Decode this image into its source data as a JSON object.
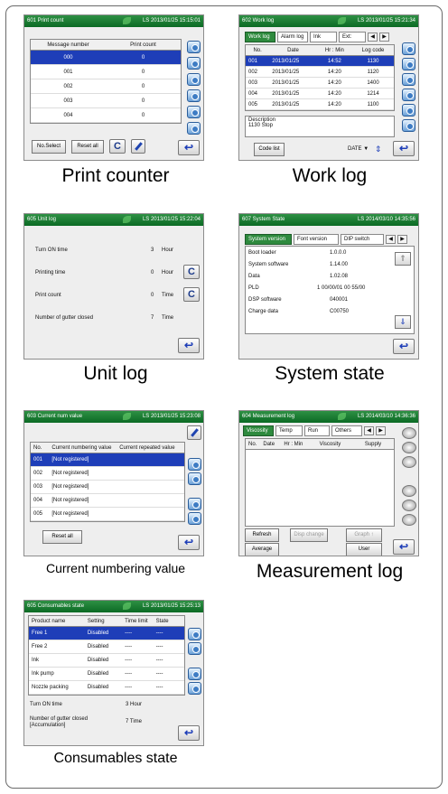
{
  "print_counter": {
    "title": "601 Print count",
    "datetime": "LS 2013/01/25 15:15:01",
    "headers": [
      "Message number",
      "Print count"
    ],
    "rows": [
      [
        "000",
        "0"
      ],
      [
        "001",
        "0"
      ],
      [
        "002",
        "0"
      ],
      [
        "003",
        "0"
      ],
      [
        "004",
        "0"
      ]
    ],
    "no_select": "No.Select",
    "reset_all": "Reset all",
    "c_glyph": "C",
    "caption": "Print counter"
  },
  "work_log": {
    "title": "602 Work log",
    "datetime": "LS 2013/01/25 15:21:34",
    "tabs": [
      "Work log",
      "Alarm log",
      "Ink",
      "Ext:"
    ],
    "headers": [
      "No.",
      "Date",
      "Hr : Min",
      "Log code"
    ],
    "rows": [
      [
        "001",
        "2013/01/25",
        "14:52",
        "1130"
      ],
      [
        "002",
        "2013/01/25",
        "14:20",
        "1120"
      ],
      [
        "003",
        "2013/01/25",
        "14:20",
        "1400"
      ],
      [
        "004",
        "2013/01/25",
        "14:20",
        "1214"
      ],
      [
        "005",
        "2013/01/25",
        "14:20",
        "1100"
      ]
    ],
    "description_label": "Description",
    "description": "1130 Stop",
    "code_list": "Code list",
    "sort": "DATE ▼",
    "caption": "Work log"
  },
  "unit_log": {
    "title": "605 Unit log",
    "datetime": "LS 2013/01/25 15:22:04",
    "items": [
      {
        "label": "Turn ON time",
        "value": "3",
        "unit": "Hour"
      },
      {
        "label": "Printing time",
        "value": "0",
        "unit": "Hour"
      },
      {
        "label": "Print count",
        "value": "0",
        "unit": "Time"
      },
      {
        "label": "Number of gutter closed",
        "value": "7",
        "unit": "Time"
      }
    ],
    "caption": "Unit log"
  },
  "system_state": {
    "title": "607 System State",
    "datetime": "LS 2014/03/10 14:35:56",
    "tabs": [
      "System version",
      "Font version",
      "DIP switch"
    ],
    "items": [
      {
        "label": "Boot loader",
        "value": "1.0.0.0"
      },
      {
        "label": "System software",
        "value": "1.14.00"
      },
      {
        "label": "Data",
        "value": "1.02.08"
      },
      {
        "label": "PLD",
        "value": "1 00/00/01  00  55/00"
      },
      {
        "label": "DSP software",
        "value": "040001"
      },
      {
        "label": "Charge data",
        "value": "C00750"
      }
    ],
    "caption": "System state"
  },
  "numbering": {
    "title": "603 Current num value",
    "datetime": "LS 2013/01/25 15:23:08",
    "headers": [
      "No.",
      "Current numbering value",
      "Current repeated value"
    ],
    "rows": [
      [
        "001",
        "[Not registered]"
      ],
      [
        "002",
        "[Not registered]"
      ],
      [
        "003",
        "[Not registered]"
      ],
      [
        "004",
        "[Not registered]"
      ],
      [
        "005",
        "[Not registered]"
      ]
    ],
    "reset_all": "Reset all",
    "caption": "Current numbering value"
  },
  "measurement": {
    "title": "604 Measurement log",
    "datetime": "LS 2014/03/10 14:36:36",
    "tabs": [
      "Viscosity",
      "Temp",
      "Run",
      "Others"
    ],
    "headers": [
      "No.",
      "Date",
      "Hr : Min",
      "Viscosity",
      "Supply"
    ],
    "refresh": "Refresh",
    "disp_change": "Disp change",
    "graph": "Graph ↑",
    "average": "Average",
    "user": "User",
    "caption": "Measurement log"
  },
  "consumables": {
    "title": "605 Consumables state",
    "datetime": "LS 2013/01/25 15:25:13",
    "headers": [
      "Product name",
      "Setting",
      "Time limit",
      "State"
    ],
    "rows": [
      [
        "Free 1",
        "Disabled",
        "----",
        "----"
      ],
      [
        "Free 2",
        "Disabled",
        "----",
        "----"
      ],
      [
        "Ink",
        "Disabled",
        "----",
        "----"
      ],
      [
        "Ink pump",
        "Disabled",
        "----",
        "----"
      ],
      [
        "Nozzle packing",
        "Disabled",
        "----",
        "----"
      ]
    ],
    "turn_on_label": "Turn ON time",
    "turn_on_value": "3 Hour",
    "gutter_label": "Number of gutter closed [Accumulation]",
    "gutter_value": "7 Time",
    "caption": "Consumables state"
  }
}
